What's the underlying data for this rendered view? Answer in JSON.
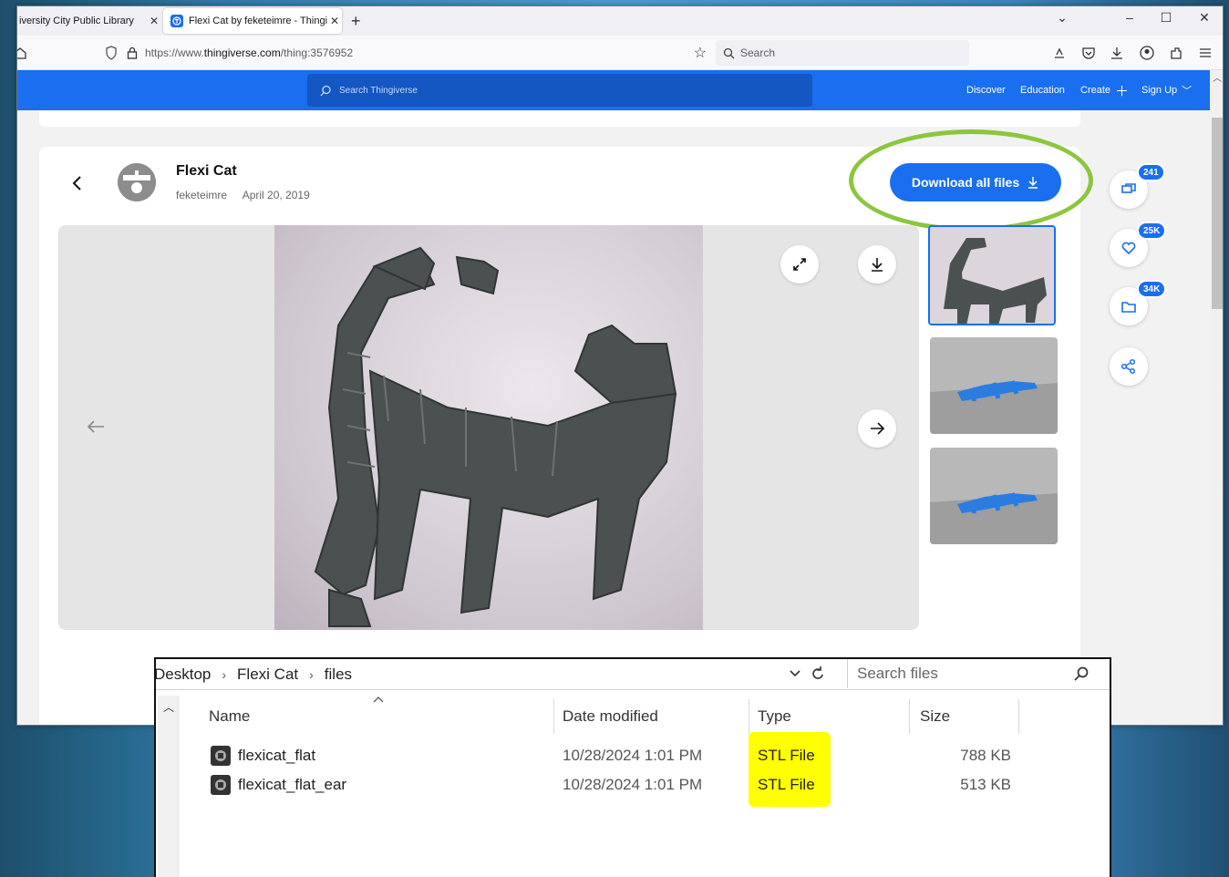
{
  "browser": {
    "tabs": [
      {
        "title": "iversity City Public Library"
      },
      {
        "title": "Flexi Cat by feketeimre - Thingiv"
      }
    ],
    "url": {
      "prefix": "https://www.",
      "domain": "thingiverse.com",
      "path": "/thing:3576952"
    },
    "search_placeholder": "Search"
  },
  "site": {
    "search_placeholder": "Search Thingiverse",
    "nav": {
      "discover": "Discover",
      "education": "Education",
      "create": "Create",
      "signup": "Sign Up"
    }
  },
  "thing": {
    "title": "Flexi Cat",
    "author": "feketeimre",
    "date": "April 20, 2019",
    "download_label": "Download all files"
  },
  "actions": {
    "comments_count": "241",
    "likes_count": "25K",
    "remix_count": "34K"
  },
  "explorer": {
    "breadcrumb": [
      "Desktop",
      "Flexi Cat",
      "files"
    ],
    "search_placeholder": "Search files",
    "columns": {
      "name": "Name",
      "date": "Date modified",
      "type": "Type",
      "size": "Size"
    },
    "files": [
      {
        "name": "flexicat_flat",
        "date": "10/28/2024 1:01 PM",
        "type": "STL File",
        "size": "788 KB"
      },
      {
        "name": "flexicat_flat_ear",
        "date": "10/28/2024 1:01 PM",
        "type": "STL File",
        "size": "513 KB"
      }
    ]
  },
  "colors": {
    "accent": "#1a6ef0",
    "ring": "#8cc63f",
    "highlight": "#ffff00"
  }
}
